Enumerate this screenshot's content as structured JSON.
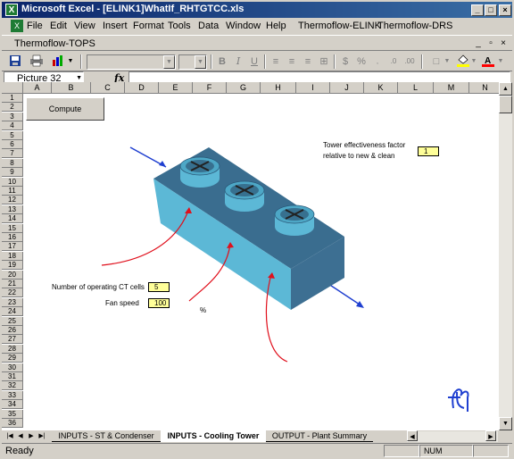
{
  "window": {
    "title": "Microsoft Excel - [ELINK1]WhatIf_RHTGTCC.xls",
    "app_icon": "excel-icon",
    "controls": {
      "minimize": "_",
      "maximize": "□",
      "close": "×"
    }
  },
  "menu": {
    "items": [
      "File",
      "Edit",
      "View",
      "Insert",
      "Format",
      "Tools",
      "Data",
      "Window",
      "Help",
      "Thermoflow-ELINK",
      "Thermoflow-DRS"
    ],
    "mdi_controls": {
      "minimize": "_",
      "restore": "▫",
      "close": "×"
    }
  },
  "tops_toolbar": {
    "label": "Thermoflow-TOPS"
  },
  "format_toolbar": {
    "bold": "B",
    "italic": "I",
    "underline": "U",
    "currency": "$",
    "percent": "%"
  },
  "formula_bar": {
    "name_box": "Picture 32",
    "fx": "fx",
    "formula": ""
  },
  "grid": {
    "columns": [
      "A",
      "B",
      "C",
      "D",
      "E",
      "F",
      "G",
      "H",
      "I",
      "J",
      "K",
      "L",
      "M",
      "N"
    ],
    "rows": [
      "1",
      "2",
      "3",
      "4",
      "5",
      "6",
      "7",
      "8",
      "9",
      "10",
      "11",
      "12",
      "13",
      "14",
      "15",
      "16",
      "17",
      "18",
      "19",
      "20",
      "21",
      "22",
      "23",
      "24",
      "25",
      "26",
      "27",
      "28",
      "29",
      "30",
      "31",
      "32",
      "33",
      "34",
      "35",
      "36"
    ]
  },
  "sheet": {
    "compute_button": "Compute",
    "effectiveness_label_line1": "Tower effectiveness factor",
    "effectiveness_label_line2": "relative to new & clean",
    "effectiveness_value": "1",
    "cells_label": "Number of operating CT cells",
    "cells_value": "5",
    "fan_speed_label": "Fan speed",
    "fan_speed_value": "100",
    "fan_speed_unit": "%",
    "logo": "thermoflow-logo"
  },
  "tabs": {
    "items": [
      "INPUTS - ST & Condenser",
      "INPUTS - Cooling Tower",
      "OUTPUT - Plant Summary"
    ],
    "active_index": 1
  },
  "status": {
    "ready": "Ready",
    "num": "NUM"
  }
}
